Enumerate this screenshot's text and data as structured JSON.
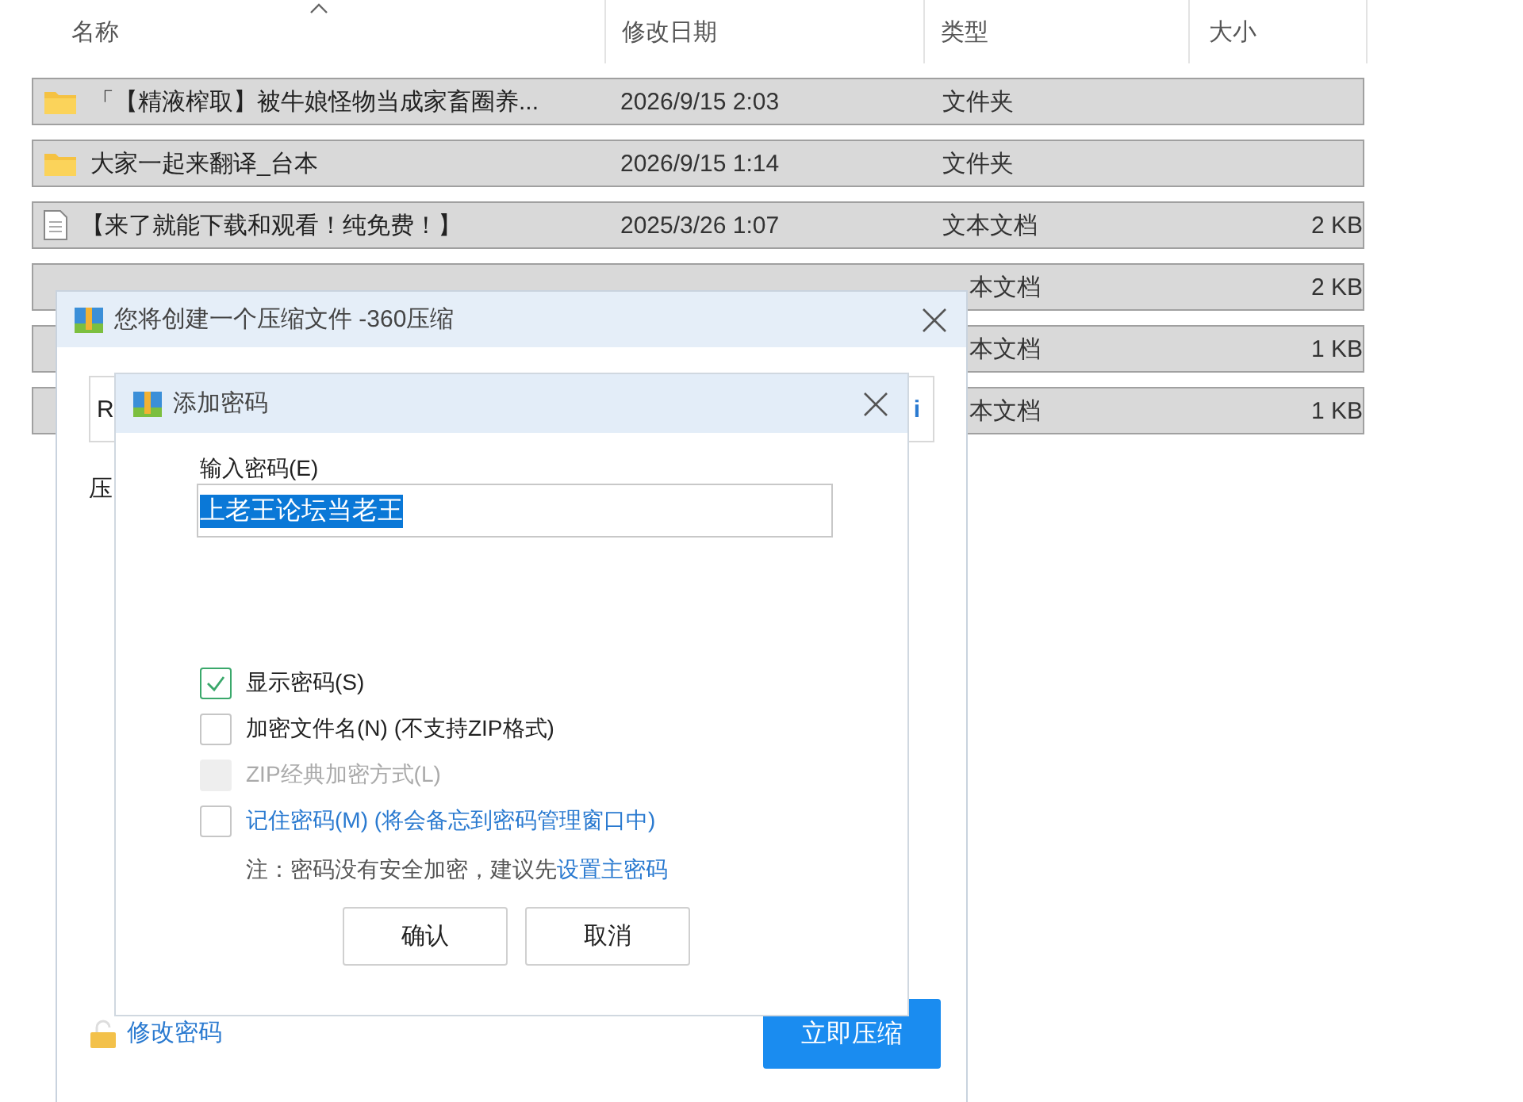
{
  "file_list": {
    "columns": [
      {
        "label": "名称",
        "sorted": true
      },
      {
        "label": "修改日期",
        "sorted": false
      },
      {
        "label": "类型",
        "sorted": false
      },
      {
        "label": "大小",
        "sorted": false
      }
    ],
    "rows": [
      {
        "kind": "folder",
        "name": "「【精液榨取】被牛娘怪物当成家畜圈养...",
        "date": "2026/9/15 2:03",
        "type": "文件夹",
        "selected": true
      },
      {
        "kind": "folder",
        "name": "大家一起来翻译_台本",
        "date": "2026/9/15 1:14",
        "type": "文件夹",
        "selected": true
      },
      {
        "kind": "text",
        "name": "【来了就能下载和观看！纯免费！】",
        "date": "2025/3/26 1:07",
        "type": "文本文档",
        "size": "2 KB",
        "selected": true
      },
      {
        "type": "本文档",
        "size": "2 KB",
        "selected": true
      },
      {
        "type": "本文档",
        "size": "1 KB",
        "selected": true
      },
      {
        "type": "本文档",
        "size": "1 KB",
        "selected": true
      }
    ]
  },
  "compress_dialog": {
    "title": "您将创建一个压缩文件 -360压缩",
    "path_value": "R",
    "path_button": "i",
    "label_fragment": "压",
    "change_password_link": "修改密码",
    "compress_button": "立即压缩"
  },
  "password_dialog": {
    "title": "添加密码",
    "password_label": "输入密码(E)",
    "password_value": "上老王论坛当老王",
    "value_highlighted": true,
    "options": [
      {
        "kind": "plain",
        "label": "显示密码(S)",
        "checked": true,
        "disabled": false
      },
      {
        "kind": "plain",
        "label": "加密文件名(N) (不支持ZIP格式)",
        "checked": false,
        "disabled": false
      },
      {
        "kind": "plain",
        "label": "ZIP经典加密方式(L)",
        "checked": false,
        "disabled": true
      },
      {
        "kind": "link",
        "label": "记住密码(M) (将会备忘到密码管理窗口中)",
        "checked": false,
        "disabled": false
      }
    ],
    "note": "注：密码没有安全加密，建议先",
    "note_link": "设置主密码",
    "buttons": [
      "确认",
      "取消"
    ]
  }
}
